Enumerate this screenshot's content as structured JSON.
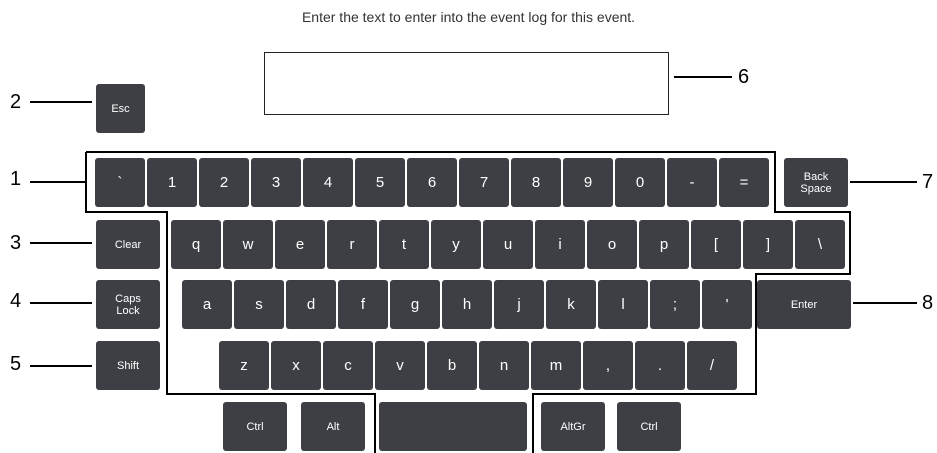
{
  "prompt": "Enter the text to enter into the event log for this event.",
  "text_input": {
    "value": ""
  },
  "keys": {
    "esc": "Esc",
    "clear": "Clear",
    "caps_lock": "Caps\nLock",
    "shift": "Shift",
    "backspace": "Back\nSpace",
    "enter": "Enter",
    "ctrl_left": "Ctrl",
    "alt": "Alt",
    "space": "",
    "altgr": "AltGr",
    "ctrl_right": "Ctrl"
  },
  "rows": {
    "number": [
      "`",
      "1",
      "2",
      "3",
      "4",
      "5",
      "6",
      "7",
      "8",
      "9",
      "0",
      "-",
      "="
    ],
    "top": [
      "q",
      "w",
      "e",
      "r",
      "t",
      "y",
      "u",
      "i",
      "o",
      "p",
      "[",
      "]",
      "\\"
    ],
    "home": [
      "a",
      "s",
      "d",
      "f",
      "g",
      "h",
      "j",
      "k",
      "l",
      ";",
      "'"
    ],
    "bottom": [
      "z",
      "x",
      "c",
      "v",
      "b",
      "n",
      "m",
      ",",
      ".",
      "/"
    ]
  },
  "callouts": {
    "n1": "1",
    "n2": "2",
    "n3": "3",
    "n4": "4",
    "n5": "5",
    "n6": "6",
    "n7": "7",
    "n8": "8"
  }
}
